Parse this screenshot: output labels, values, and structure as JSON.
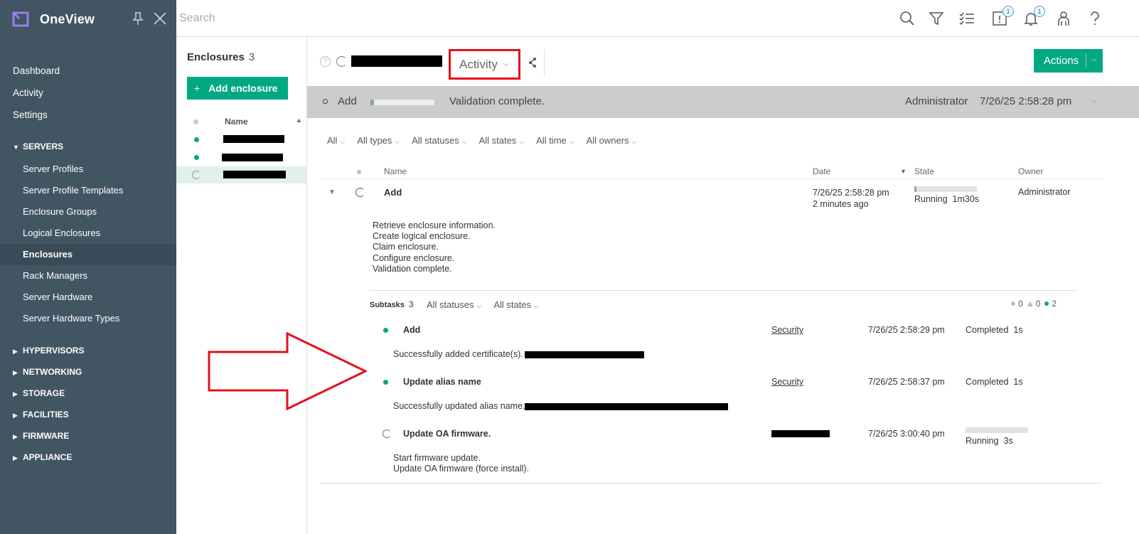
{
  "sidebar": {
    "brand": "OneView",
    "top_items": [
      "Dashboard",
      "Activity",
      "Settings"
    ],
    "servers_group": "SERVERS",
    "servers_items": [
      "Server Profiles",
      "Server Profile Templates",
      "Enclosure Groups",
      "Logical Enclosures",
      "Enclosures",
      "Rack Managers",
      "Server Hardware",
      "Server Hardware Types"
    ],
    "collapsed_groups": [
      "HYPERVISORS",
      "NETWORKING",
      "STORAGE",
      "FACILITIES",
      "FIRMWARE",
      "APPLIANCE"
    ]
  },
  "topbar": {
    "search_placeholder": "Search",
    "icons": [
      "search-icon",
      "filter-icon",
      "tasks-icon",
      "alerts-icon",
      "notifications-icon",
      "user-icon",
      "help-icon"
    ],
    "alerts_badge": "1",
    "notifications_badge": "1"
  },
  "enclosure_list": {
    "title": "Enclosures",
    "count": "3",
    "add_button": "Add enclosure",
    "add_plus": "+",
    "name_header": "Name",
    "sort_glyph": "▲"
  },
  "main": {
    "view_selector": "Activity",
    "actions_button": "Actions",
    "banner": {
      "name": "Add",
      "progress": 0.05,
      "message": "Validation complete.",
      "owner": "Administrator",
      "time": "7/26/25  2:58:28 pm"
    },
    "filters": [
      "All",
      "All types",
      "All statuses",
      "All states",
      "All time",
      "All owners"
    ],
    "table_headers": {
      "name": "Name",
      "date": "Date",
      "state": "State",
      "owner": "Owner",
      "date_sort": "▼"
    },
    "task": {
      "name": "Add",
      "date": "7/26/25  2:58:28 pm",
      "relative": "2 minutes ago",
      "state": "Running",
      "duration": "1m30s",
      "progress": 0.03,
      "owner": "Administrator",
      "steps": [
        "Retrieve enclosure information.",
        "Create logical enclosure.",
        "Claim enclosure.",
        "Configure enclosure.",
        "Validation complete."
      ]
    },
    "subtasks": {
      "label": "Subtasks",
      "count": "3",
      "filters": [
        "All statuses",
        "All states"
      ],
      "counts": {
        "unknown": "0",
        "warning": "0",
        "ok": "2"
      },
      "items": [
        {
          "name": "Add",
          "category": "Security",
          "date": "7/26/25  2:58:29 pm",
          "state": "Completed",
          "duration": "1s",
          "description": "Successfully added certificate(s). :"
        },
        {
          "name": "Update alias name",
          "category": "Security",
          "date": "7/26/25  2:58:37 pm",
          "state": "Completed",
          "duration": "1s",
          "description": "Successfully updated alias name. :"
        },
        {
          "name": "Update OA firmware.",
          "category": "",
          "date": "7/26/25  3:00:40 pm",
          "state": "Running",
          "duration": "3s",
          "progress": 0,
          "description_lines": [
            "Start firmware update.",
            "Update OA firmware (force install)."
          ]
        }
      ]
    }
  },
  "colors": {
    "sidebar_bg": "#425563",
    "accent_green": "#01a982",
    "annotation_red": "#e3101c",
    "brand_purple": "#7630ea"
  }
}
